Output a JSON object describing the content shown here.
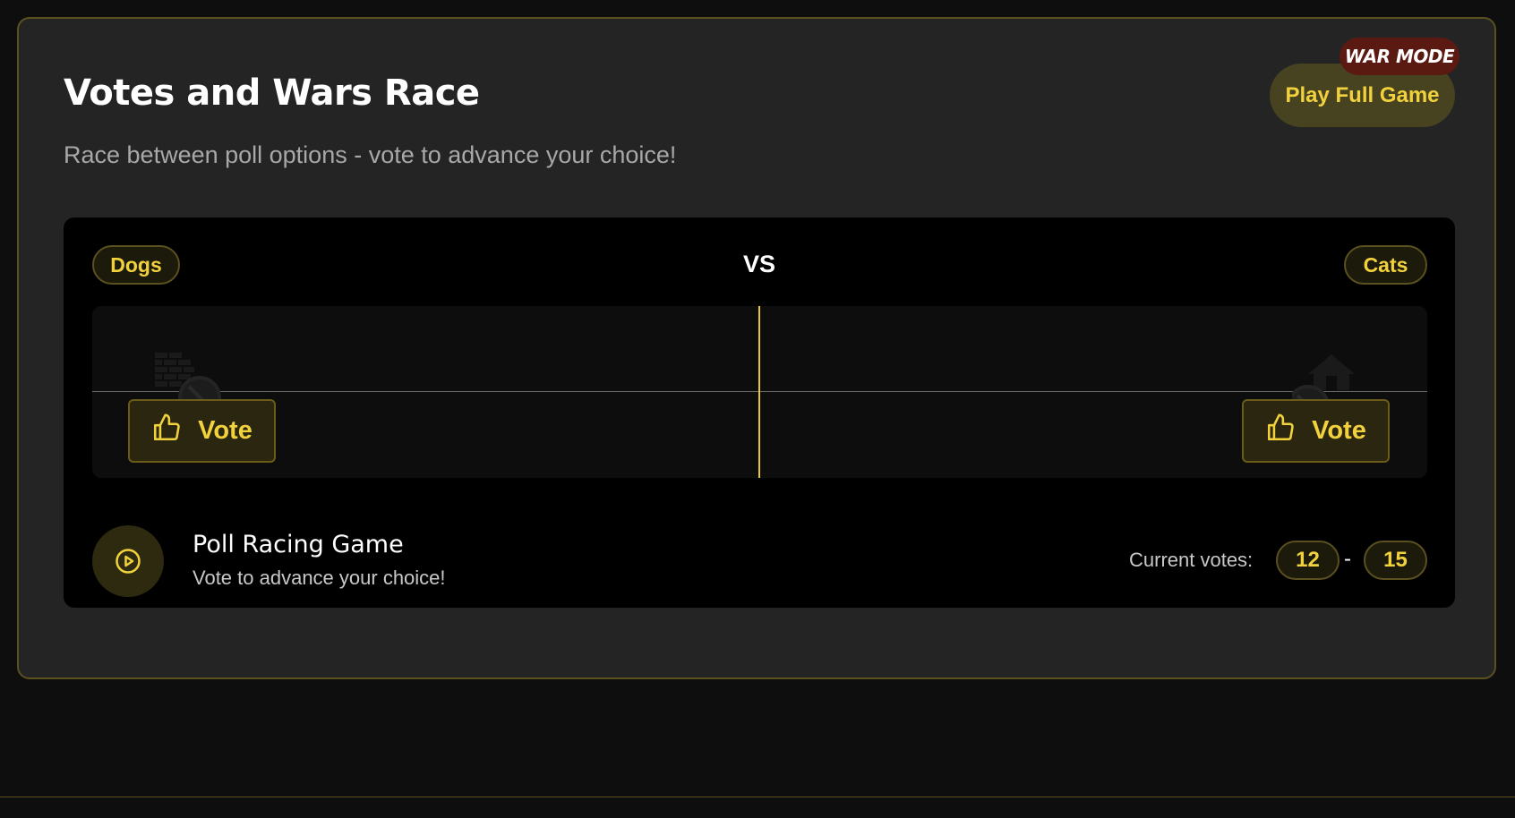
{
  "header": {
    "title": "Votes and Wars Race",
    "subtitle": "Race between poll options - vote to advance your choice!",
    "play_button_label": "Play Full Game",
    "badge": "WAR MODE"
  },
  "race": {
    "left_option": "Dogs",
    "right_option": "Cats",
    "vs_label": "VS",
    "vote_label": "Vote",
    "left_racer_icon": "brick-wall-icon",
    "right_racer_icon": "house-icon",
    "vote_icon": "thumbs-up-icon"
  },
  "game": {
    "title": "Poll Racing Game",
    "subtitle": "Vote to advance your choice!",
    "icon": "play-circle-icon"
  },
  "votes": {
    "label": "Current votes:",
    "left": "12",
    "separator": "-",
    "right": "15"
  },
  "colors": {
    "accent": "#f2d23c",
    "background": "#0e0e0e",
    "card": "#242424",
    "badge": "#5a1a12"
  }
}
